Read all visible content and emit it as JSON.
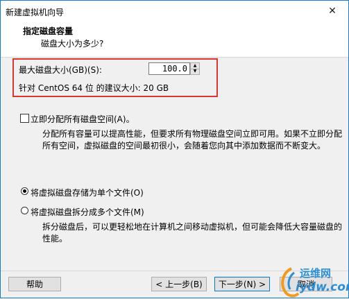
{
  "window": {
    "title": "新建虚拟机向导",
    "close_glyph": "✕"
  },
  "header": {
    "title": "指定磁盘容量",
    "subtitle": "磁盘大小为多少?"
  },
  "disk": {
    "max_size_label": "最大磁盘大小(GB)(S):",
    "max_size_value": "100.0",
    "recommend_text": "针对 CentOS 64 位 的建议大小: 20 GB"
  },
  "allocate": {
    "checkbox_label": "立即分配所有磁盘空间(A)。",
    "checked": false,
    "description_line1": "分配所有容量可以提高性能，但要求所有物理磁盘空间立即可用。如果不立即分配",
    "description_line2": "所有空间，虚拟磁盘的空间最初很小，会随着您向其中添加数据而不断变大。"
  },
  "storage": {
    "single_file_label": "将虚拟磁盘存储为单个文件(O)",
    "single_file_selected": true,
    "multi_file_label": "将虚拟磁盘拆分成多个文件(M)",
    "multi_file_selected": false,
    "multi_description_line1": "拆分磁盘后，可以更轻松地在计算机之间移动虚拟机，但可能会降低大容量磁盘的",
    "multi_description_line2": "性能。"
  },
  "buttons": {
    "help": "帮助",
    "back": "< 上一步(B)",
    "next": "下一步(N) >",
    "cancel": "取消"
  },
  "watermark": {
    "line1": "运维网",
    "line2": "iydw.com"
  },
  "colors": {
    "highlight": "#e0352f",
    "accent": "#0078d7",
    "watermark": "#2c8fd6"
  }
}
